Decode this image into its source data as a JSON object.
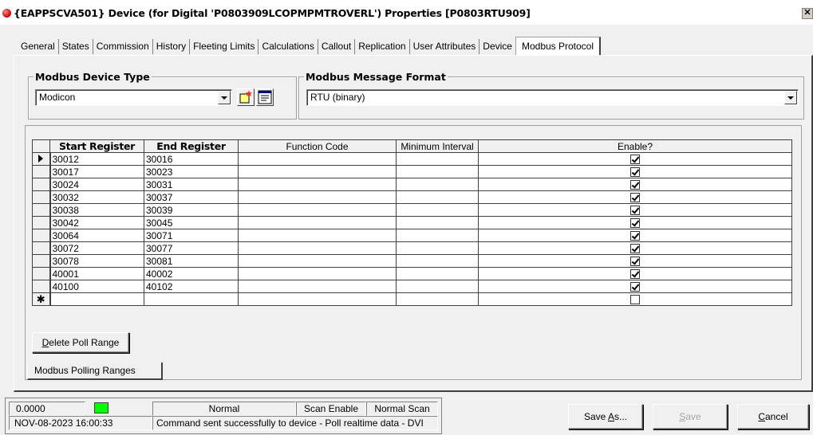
{
  "window": {
    "title": "{EAPPSCVA501} Device (for Digital 'P0803909LCOPMPMTROVERL') Properties [P0803RTU909]",
    "close_glyph": "✕"
  },
  "tabs": [
    {
      "label": "General"
    },
    {
      "label": "States"
    },
    {
      "label": "Commission"
    },
    {
      "label": "History"
    },
    {
      "label": "Fleeting Limits"
    },
    {
      "label": "Calculations"
    },
    {
      "label": "Callout"
    },
    {
      "label": "Replication"
    },
    {
      "label": "User Attributes"
    },
    {
      "label": "Device"
    },
    {
      "label": "Modbus Protocol"
    }
  ],
  "modbus_device_type": {
    "label": "Modbus Device Type",
    "value": "Modicon"
  },
  "modbus_message_format": {
    "label": "Modbus Message Format",
    "value": "RTU (binary)"
  },
  "grid": {
    "columns": [
      "Start Register",
      "End Register",
      "Function Code",
      "Minimum Interval",
      "Enable?"
    ],
    "rows": [
      {
        "start": "30012",
        "end": "30016",
        "function": "",
        "interval": "",
        "enabled": true
      },
      {
        "start": "30017",
        "end": "30023",
        "function": "",
        "interval": "",
        "enabled": true
      },
      {
        "start": "30024",
        "end": "30031",
        "function": "",
        "interval": "",
        "enabled": true
      },
      {
        "start": "30032",
        "end": "30037",
        "function": "",
        "interval": "",
        "enabled": true
      },
      {
        "start": "30038",
        "end": "30039",
        "function": "",
        "interval": "",
        "enabled": true
      },
      {
        "start": "30042",
        "end": "30045",
        "function": "",
        "interval": "",
        "enabled": true
      },
      {
        "start": "30064",
        "end": "30071",
        "function": "",
        "interval": "",
        "enabled": true
      },
      {
        "start": "30072",
        "end": "30077",
        "function": "",
        "interval": "",
        "enabled": true
      },
      {
        "start": "30078",
        "end": "30081",
        "function": "",
        "interval": "",
        "enabled": true
      },
      {
        "start": "40001",
        "end": "40002",
        "function": "",
        "interval": "",
        "enabled": true
      },
      {
        "start": "40100",
        "end": "40102",
        "function": "",
        "interval": "",
        "enabled": true
      }
    ],
    "new_row_glyph": "✱"
  },
  "buttons": {
    "delete_poll_range": "Delete Poll Range",
    "save_as": "Save As...",
    "save": "Save",
    "cancel": "Cancel"
  },
  "bottom_tab": "Modbus Polling Ranges",
  "status": {
    "value": "0.0000",
    "state": "Normal",
    "scan_enable": "Scan Enable",
    "scan_mode": "Normal Scan",
    "timestamp": "NOV-08-2023 16:00:33",
    "message": "Command sent successfully to device - Poll realtime data - DVI",
    "indicator_color": "#00ff00"
  }
}
